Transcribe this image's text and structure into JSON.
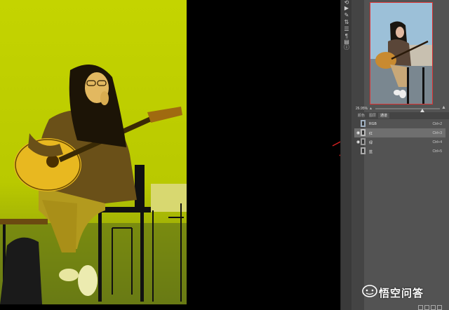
{
  "navigator": {
    "zoom": "26.95%"
  },
  "panel_tabs": [
    {
      "label": "颜色"
    },
    {
      "label": "图层"
    },
    {
      "label": "通道"
    }
  ],
  "channels": [
    {
      "name": "RGB",
      "shortcut": "Ctrl+2",
      "visible": false,
      "selected": false
    },
    {
      "name": "红",
      "shortcut": "Ctrl+3",
      "visible": true,
      "selected": true
    },
    {
      "name": "绿",
      "shortcut": "Ctrl+4",
      "visible": true,
      "selected": false
    },
    {
      "name": "蓝",
      "shortcut": "Ctrl+5",
      "visible": false,
      "selected": false
    }
  ],
  "watermark": {
    "text": "悟空问答"
  },
  "colors": {
    "canvas_tint": "#c8d400",
    "panel_bg": "#535353",
    "selected_row": "#6f6f6f",
    "annotation_arrow": "#d42020"
  }
}
